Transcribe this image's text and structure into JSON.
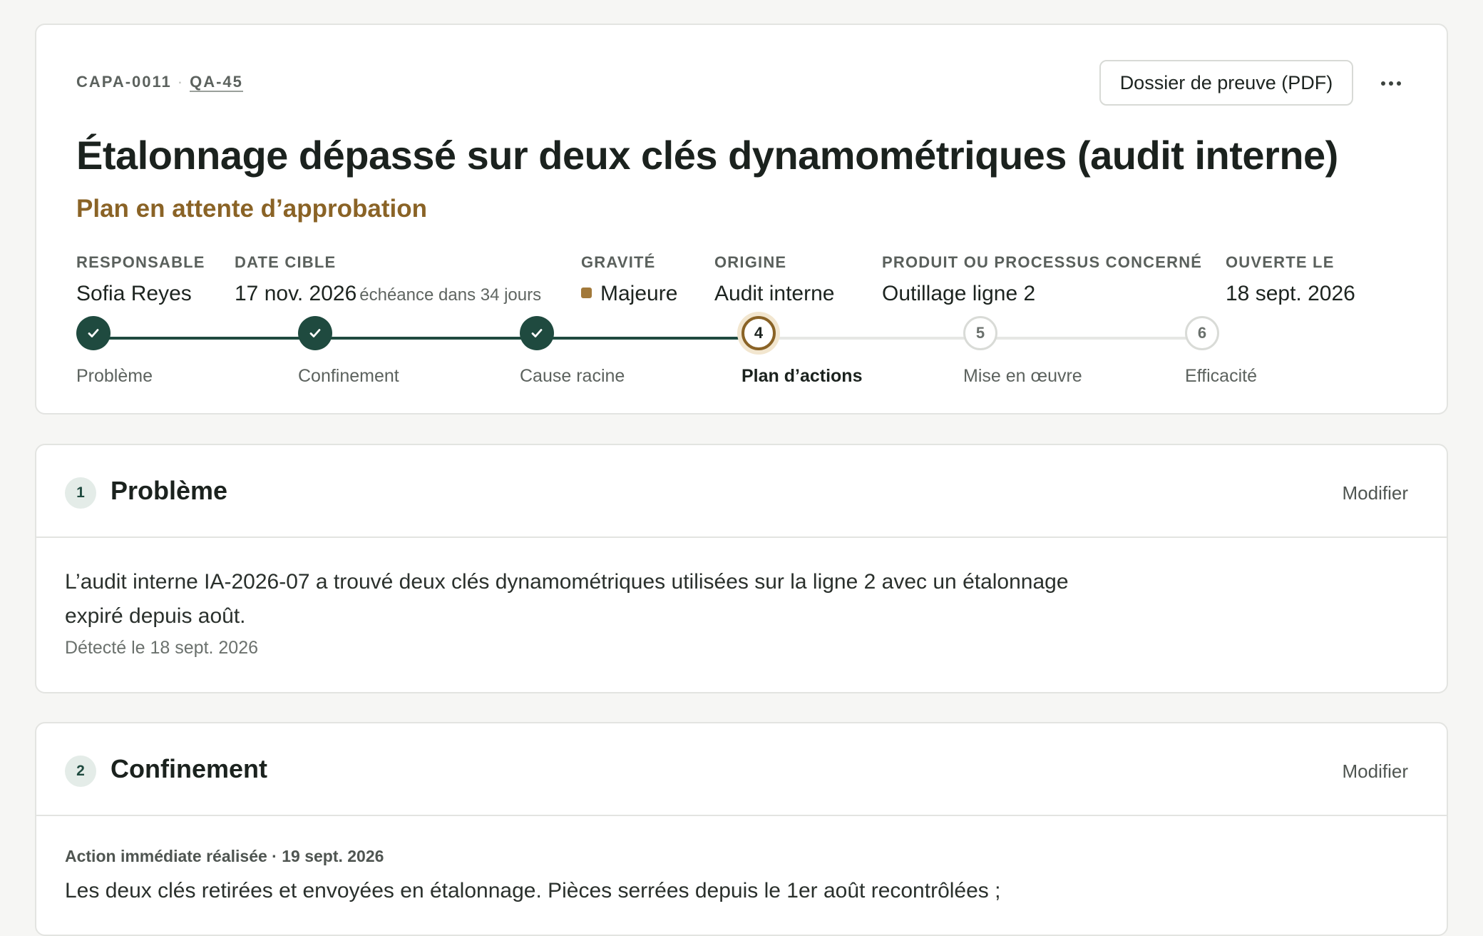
{
  "header": {
    "capa_id": "CAPA-0011",
    "separator": "·",
    "qa_ref": "QA-45",
    "evidence_button": "Dossier de preuve (PDF)",
    "title": "Étalonnage dépassé sur deux clés dynamométriques (audit interne)",
    "status": "Plan en attente d’approbation"
  },
  "meta": {
    "owner": {
      "label": "RESPONSABLE",
      "value": "Sofia Reyes"
    },
    "target_date": {
      "label": "DATE CIBLE",
      "value": "17 nov. 2026",
      "note": "échéance dans 34 jours"
    },
    "severity": {
      "label": "GRAVITÉ",
      "value": "Majeure",
      "color": "#a2793a"
    },
    "origin": {
      "label": "ORIGINE",
      "value": "Audit interne"
    },
    "product": {
      "label": "PRODUIT OU PROCESSUS CONCERNÉ",
      "value": "Outillage ligne 2"
    },
    "opened": {
      "label": "OUVERTE LE",
      "value": "18 sept. 2026"
    }
  },
  "stepper": {
    "current_index": 3,
    "steps": [
      {
        "number": "1",
        "label": "Problème",
        "state": "done"
      },
      {
        "number": "2",
        "label": "Confinement",
        "state": "done"
      },
      {
        "number": "3",
        "label": "Cause racine",
        "state": "done"
      },
      {
        "number": "4",
        "label": "Plan d’actions",
        "state": "current"
      },
      {
        "number": "5",
        "label": "Mise en œuvre",
        "state": "todo"
      },
      {
        "number": "6",
        "label": "Efficacité",
        "state": "todo"
      }
    ]
  },
  "sections": {
    "problem": {
      "number": "1",
      "title": "Problème",
      "edit": "Modifier",
      "description": "L’audit interne IA-2026-07 a trouvé deux clés dynamométriques utilisées sur la ligne 2 avec un étalonnage expiré depuis août.",
      "detected": "Détecté le 18 sept. 2026"
    },
    "containment": {
      "number": "2",
      "title": "Confinement",
      "edit": "Modifier",
      "action_meta": "Action immédiate réalisée · 19 sept. 2026",
      "action_text": "Les deux clés retirées et envoyées en étalonnage. Pièces serrées depuis le 1er août recontrôlées ;"
    }
  },
  "colors": {
    "accent_green": "#1f4a3f",
    "status_amber": "#8a6326"
  }
}
